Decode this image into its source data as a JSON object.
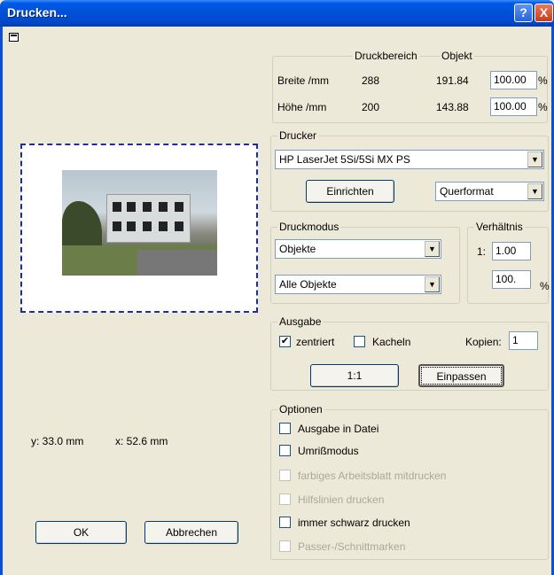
{
  "window": {
    "title": "Drucken...",
    "help_glyph": "?",
    "close_glyph": "X"
  },
  "preview": {
    "y_coord": "y: 33.0 mm",
    "x_coord": "x: 52.6 mm"
  },
  "dimensions": {
    "header_druckbereich": "Druckbereich",
    "header_objekt": "Objekt",
    "width_label": "Breite /mm",
    "width_druckbereich": "288",
    "width_objekt": "191.84",
    "width_percent_value": "100.00",
    "height_label": "Höhe /mm",
    "height_druckbereich": "200",
    "height_objekt": "143.88",
    "height_percent_value": "100.00",
    "percent_unit": "%"
  },
  "drucker": {
    "legend": "Drucker",
    "printer_selected": "HP LaserJet 5Si/5Si MX PS",
    "setup_button": "Einrichten",
    "orientation_selected": "Querformat"
  },
  "druckmodus": {
    "legend": "Druckmodus",
    "mode_selected": "Objekte",
    "scope_selected": "Alle Objekte"
  },
  "verhaeltnis": {
    "legend": "Verhältnis",
    "ratio_prefix": "1:",
    "ratio_value": "1.00",
    "percent_value": "100.",
    "percent_unit": "%"
  },
  "ausgabe": {
    "legend": "Ausgabe",
    "centered_label": "zentriert",
    "centered_checked": true,
    "tiles_label": "Kacheln",
    "tiles_checked": false,
    "copies_label": "Kopien:",
    "copies_value": "1",
    "one_to_one_button": "1:1",
    "fit_button": "Einpassen"
  },
  "optionen": {
    "legend": "Optionen",
    "items": [
      {
        "label": "Ausgabe in Datei",
        "enabled": true,
        "checked": false
      },
      {
        "label": "Umrißmodus",
        "enabled": true,
        "checked": false
      },
      {
        "label": "farbiges Arbeitsblatt mitdrucken",
        "enabled": false,
        "checked": false
      },
      {
        "label": "Hilfslinien drucken",
        "enabled": false,
        "checked": false
      },
      {
        "label": "immer schwarz drucken",
        "enabled": true,
        "checked": false
      },
      {
        "label": "Passer-/Schnittmarken",
        "enabled": false,
        "checked": false
      }
    ]
  },
  "buttons": {
    "ok": "OK",
    "cancel": "Abbrechen"
  },
  "colors": {
    "titlebar": "#0050d8",
    "dialog_bg": "#ece9d8",
    "preview_border": "#1a2ea0",
    "disabled_text": "#aca899"
  }
}
